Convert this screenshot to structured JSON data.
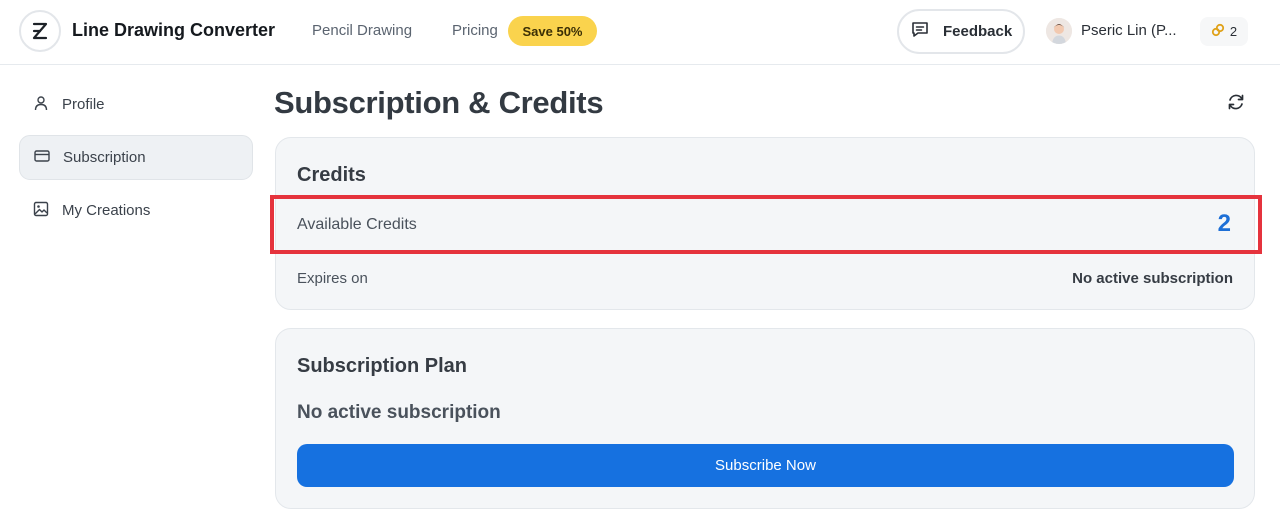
{
  "header": {
    "app_title": "Line Drawing Converter",
    "nav": [
      {
        "label": "Pencil Drawing"
      },
      {
        "label": "Pricing"
      }
    ],
    "pricing_badge": "Save 50%",
    "feedback_label": "Feedback",
    "user_name": "Pseric Lin (P...",
    "credits_count": "2",
    "icons": {
      "logo": "logo-icon",
      "feedback": "message-icon",
      "avatar": "avatar",
      "credits": "link-coins-icon"
    }
  },
  "sidebar": {
    "items": [
      {
        "label": "Profile",
        "icon": "user-icon",
        "active": false
      },
      {
        "label": "Subscription",
        "icon": "credit-card-icon",
        "active": true
      },
      {
        "label": "My Creations",
        "icon": "image-icon",
        "active": false
      }
    ]
  },
  "main": {
    "title": "Subscription & Credits",
    "refresh_icon": "refresh-icon",
    "credits_card": {
      "heading": "Credits",
      "available_label": "Available Credits",
      "available_value": "2",
      "expires_label": "Expires on",
      "expires_value": "No active subscription"
    },
    "plan_card": {
      "heading": "Subscription Plan",
      "status": "No active subscription",
      "subscribe_button": "Subscribe Now"
    }
  },
  "colors": {
    "accent": "#1671e0",
    "credits_value": "#1d6fd6",
    "highlight_border": "#e5333d",
    "badge": "#fad34d"
  }
}
